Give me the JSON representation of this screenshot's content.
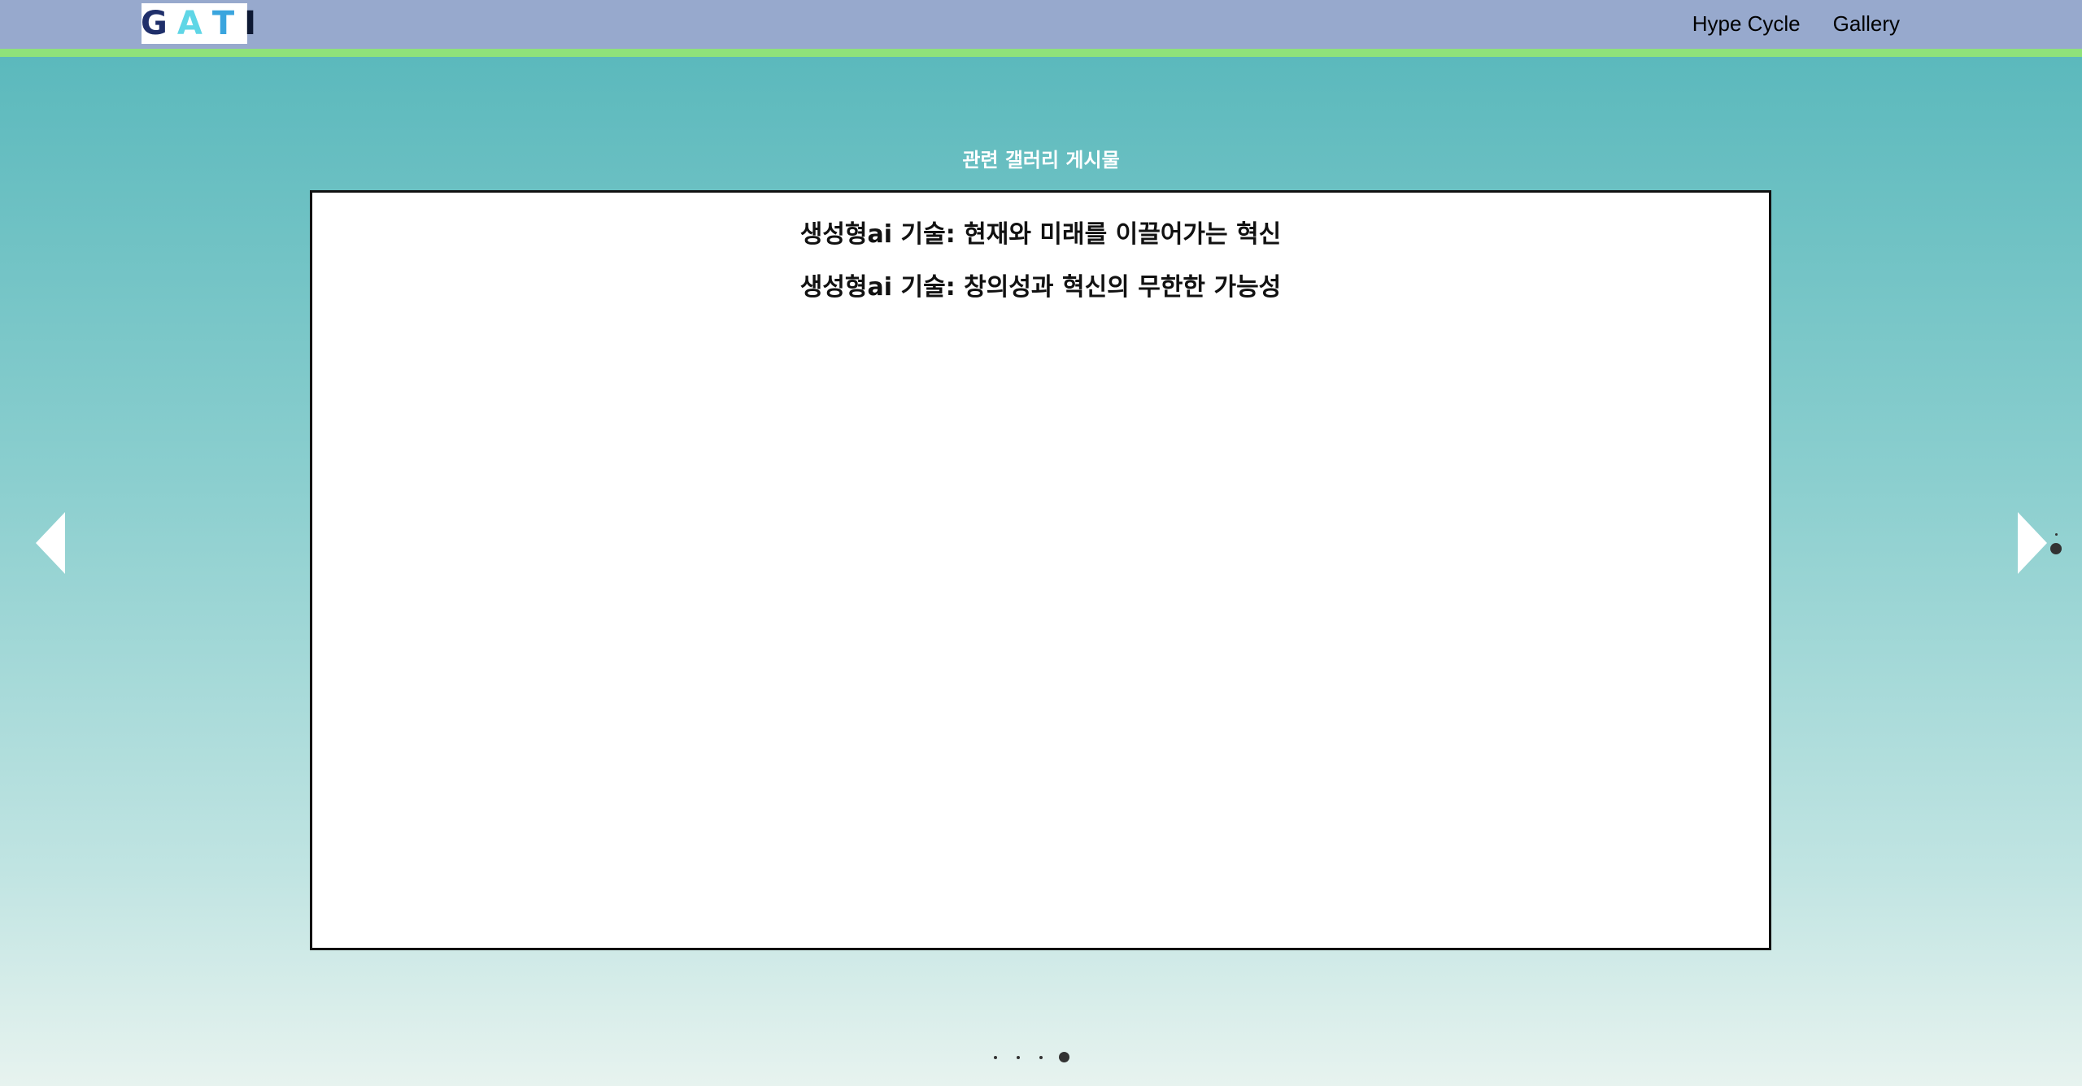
{
  "header": {
    "logo_letters": [
      "G",
      "A",
      "T",
      "I"
    ],
    "nav": [
      "Hype Cycle",
      "Gallery"
    ]
  },
  "section_title": "관련 갤러리 게시물",
  "posts": [
    "생성형ai 기술: 현재와 미래를 이끌어가는 혁신",
    "생성형ai 기술: 창의성과 혁신의 무한한 가능성"
  ],
  "carousel": {
    "dot_count": 4,
    "active_index": 3
  },
  "colors": {
    "header_bg": "#97a9cd",
    "header_accent": "#8fe27a",
    "gradient_top": "#55b6ba",
    "gradient_bottom": "#e7f3ef"
  },
  "icons": {
    "prev": "triangle-left-icon",
    "next": "triangle-right-icon"
  }
}
